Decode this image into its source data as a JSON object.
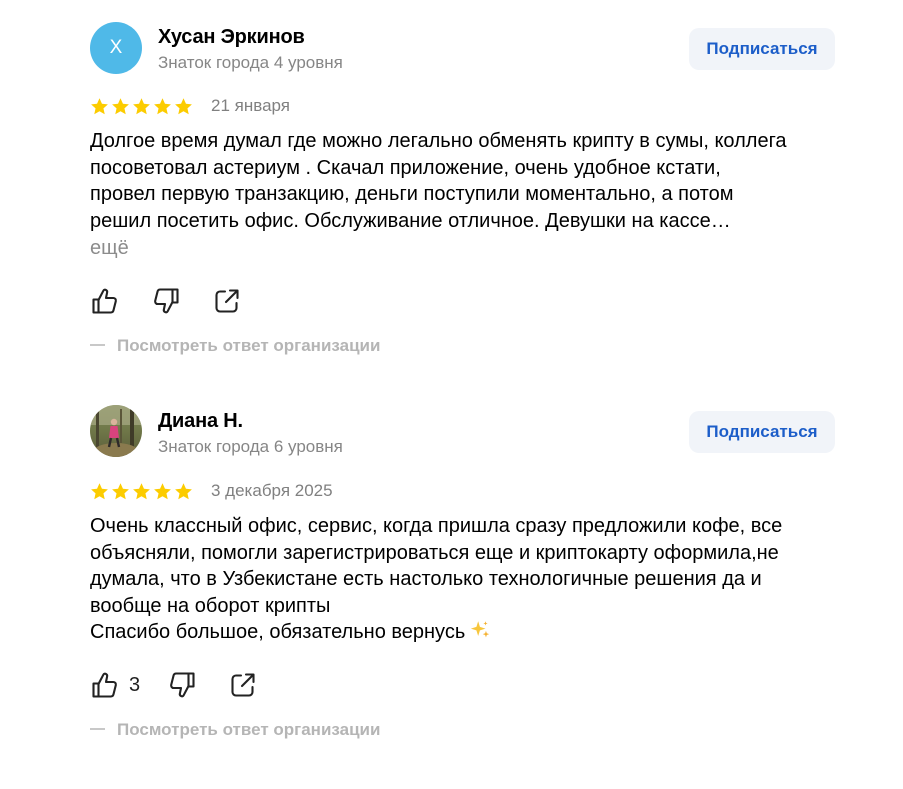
{
  "colors": {
    "star": "#fccc00",
    "link_blue": "#1d5ec9",
    "avatar_blue": "#4fb9e8",
    "muted": "#868686",
    "button_bg": "#f1f4f9"
  },
  "reviews": [
    {
      "avatar": {
        "type": "initial",
        "initial": "Х",
        "color": "#4fb9e8"
      },
      "author_name": "Хусан Эркинов",
      "author_level": "Знаток города 4 уровня",
      "subscribe_label": "Подписаться",
      "rating": 5,
      "date": "21 января",
      "text_lines": [
        "Долгое время думал где можно легально обменять крипту в сумы, коллега",
        "посоветовал астериум . Скачал приложение, очень удобное кстати,",
        "провел первую транзакцию, деньги поступили моментально, а потом",
        "решил посетить офис. Обслуживание отличное. Девушки на кассе…"
      ],
      "more_label": "ещё",
      "likes": "",
      "org_response_label": "Посмотреть ответ организации"
    },
    {
      "avatar": {
        "type": "photo",
        "icon": "user-photo"
      },
      "author_name": "Диана Н.",
      "author_level": "Знаток города 6 уровня",
      "subscribe_label": "Подписаться",
      "rating": 5,
      "date": "3 декабря 2025",
      "text_lines": [
        "Очень классный офис, сервис, когда пришла сразу предложили кофе, все",
        "объясняли, помогли зарегистрироваться еще и криптокарту оформила,не",
        "думала, что в Узбекистане есть настолько технологичные решения да и",
        "вообще на оборот крипты",
        "Спасибо большое, обязательно вернусь"
      ],
      "text_emoji": "sparkles-icon",
      "more_label": "",
      "likes": "3",
      "org_response_label": "Посмотреть ответ организации"
    }
  ]
}
